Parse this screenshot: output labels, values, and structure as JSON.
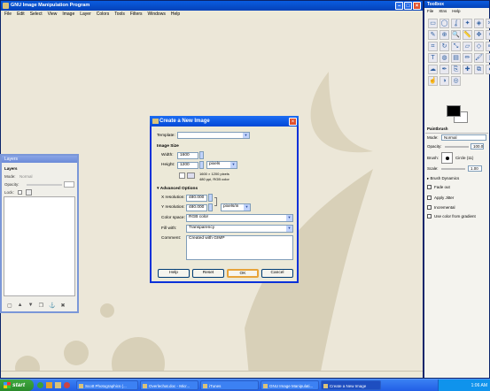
{
  "main_window": {
    "title": "GNU Image Manipulation Program",
    "menu": [
      "File",
      "Edit",
      "Select",
      "View",
      "Image",
      "Layer",
      "Colors",
      "Tools",
      "Filters",
      "Windows",
      "Help"
    ]
  },
  "layers_dock": {
    "title": "Layers",
    "header": "Layers",
    "mode_label": "Mode:",
    "mode_value": "Normal",
    "opacity_label": "Opacity:",
    "lock_label": "Lock:"
  },
  "toolbox": {
    "title": "Toolbox",
    "menu": [
      "File",
      "Xtns",
      "Help"
    ],
    "tool_icons": [
      "rect-select-icon",
      "ellipse-select-icon",
      "lasso-icon",
      "fuzzy-select-icon",
      "color-select-icon",
      "scissors-icon",
      "paths-icon",
      "color-picker-icon",
      "zoom-icon",
      "measure-icon",
      "move-icon",
      "align-icon",
      "crop-icon",
      "rotate-icon",
      "scale-icon",
      "shear-icon",
      "perspective-icon",
      "flip-icon",
      "text-icon",
      "bucket-icon",
      "blend-icon",
      "pencil-icon",
      "paintbrush-icon",
      "eraser-icon",
      "airbrush-icon",
      "ink-icon",
      "clone-icon",
      "heal-icon",
      "perspective-clone-icon",
      "convolve-icon",
      "smudge-icon",
      "dodge-icon",
      "foreground-select-icon"
    ]
  },
  "paintbrush": {
    "title": "Paintbrush",
    "mode_label": "Mode:",
    "mode_value": "Normal",
    "opacity_label": "Opacity:",
    "opacity_value": "100.0",
    "brush_label": "Brush:",
    "brush_value": "Circle (11)",
    "scale_label": "Scale:",
    "scale_value": "1.00",
    "brush_dynamics": "Brush Dynamics",
    "fade_out": "Fade out",
    "apply_jitter": "Apply Jitter",
    "incremental": "Incremental",
    "use_color_gradient": "Use color from gradient"
  },
  "dialog": {
    "title": "Create a New Image",
    "template_label": "Template:",
    "template_value": "",
    "image_size_header": "Image Size",
    "width_label": "Width:",
    "width_value": "1600",
    "height_label": "Height:",
    "height_value": "1200",
    "unit_value": "pixels",
    "size_info_1": "1600 × 1200 pixels",
    "size_info_2": "480 ppi, RGB color",
    "advanced_label": "Advanced Options",
    "xres_label": "X resolution:",
    "xres_value": "480.000",
    "yres_label": "Y resolution:",
    "yres_value": "480.000",
    "res_unit_value": "pixels/in",
    "colorspace_label": "Color space:",
    "colorspace_value": "RGB color",
    "fill_label": "Fill with:",
    "fill_value": "Transparency",
    "comment_label": "Comment:",
    "comment_value": "Created with GIMP",
    "help_button": "Help",
    "reset_button": "Reset",
    "ok_button": "OK",
    "cancel_button": "Cancel"
  },
  "taskbar": {
    "start_label": "start",
    "items": [
      {
        "label": "Scott Photographics (..."
      },
      {
        "label": "Overlechat.doc - Micr..."
      },
      {
        "label": "iTunes"
      },
      {
        "label": "GNU Image Manipulati..."
      },
      {
        "label": "Create a New Image"
      }
    ],
    "clock": "1:06 AM"
  },
  "colors": {
    "xp_blue": "#0a5ce0",
    "dialog_bg": "#ece9d8",
    "canvas_bg": "#ece7d8",
    "shape": "#d4ccb4"
  }
}
